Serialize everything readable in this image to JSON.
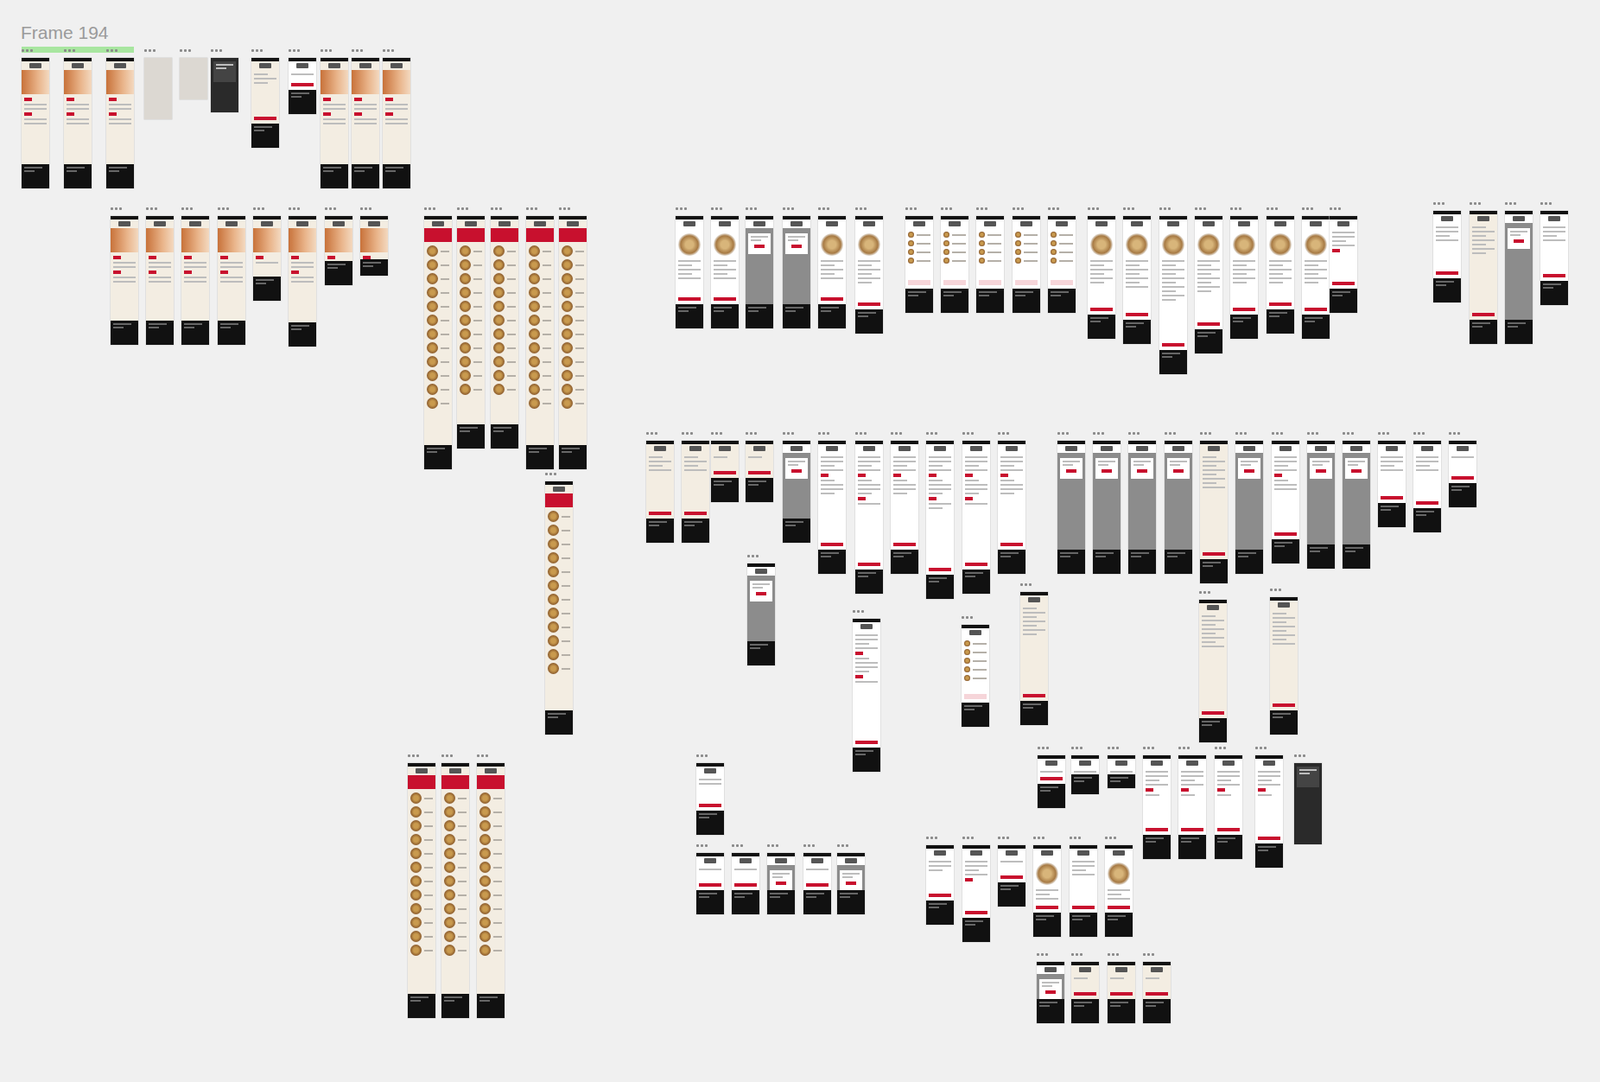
{
  "canvas": {
    "title": "Frame 194"
  },
  "frames": [
    {
      "kind": "hero"
    },
    {
      "kind": "hero"
    },
    {
      "kind": "hero"
    },
    {
      "kind": "blank"
    },
    {
      "kind": "blank"
    },
    {
      "kind": "dark"
    },
    {
      "kind": "beige"
    },
    {
      "kind": "form"
    },
    {
      "kind": "hero"
    },
    {
      "kind": "hero"
    },
    {
      "kind": "hero"
    },
    {
      "kind": "hero"
    },
    {
      "kind": "hero"
    },
    {
      "kind": "hero"
    },
    {
      "kind": "hero"
    },
    {
      "kind": "hero"
    },
    {
      "kind": "hero"
    },
    {
      "kind": "hero"
    },
    {
      "kind": "hero"
    },
    {
      "kind": "menu"
    },
    {
      "kind": "menu"
    },
    {
      "kind": "menu"
    },
    {
      "kind": "menu"
    },
    {
      "kind": "menu"
    },
    {
      "kind": "menu"
    },
    {
      "kind": "product"
    },
    {
      "kind": "product"
    },
    {
      "kind": "modal"
    },
    {
      "kind": "modal"
    },
    {
      "kind": "product"
    },
    {
      "kind": "product"
    },
    {
      "kind": "list"
    },
    {
      "kind": "list"
    },
    {
      "kind": "list"
    },
    {
      "kind": "list"
    },
    {
      "kind": "list"
    },
    {
      "kind": "product"
    },
    {
      "kind": "product"
    },
    {
      "kind": "product"
    },
    {
      "kind": "product"
    },
    {
      "kind": "product"
    },
    {
      "kind": "product"
    },
    {
      "kind": "product"
    },
    {
      "kind": "form"
    },
    {
      "kind": "form"
    },
    {
      "kind": "beige"
    },
    {
      "kind": "modal"
    },
    {
      "kind": "form"
    },
    {
      "kind": "beige"
    },
    {
      "kind": "beige"
    },
    {
      "kind": "beige"
    },
    {
      "kind": "beige"
    },
    {
      "kind": "modal"
    },
    {
      "kind": "form"
    },
    {
      "kind": "form"
    },
    {
      "kind": "form"
    },
    {
      "kind": "form"
    },
    {
      "kind": "form"
    },
    {
      "kind": "form"
    },
    {
      "kind": "modal"
    },
    {
      "kind": "modal"
    },
    {
      "kind": "modal"
    },
    {
      "kind": "modal"
    },
    {
      "kind": "beige"
    },
    {
      "kind": "modal"
    },
    {
      "kind": "form"
    },
    {
      "kind": "modal"
    },
    {
      "kind": "modal"
    },
    {
      "kind": "form"
    },
    {
      "kind": "form"
    },
    {
      "kind": "form"
    },
    {
      "kind": "modal"
    },
    {
      "kind": "form"
    },
    {
      "kind": "list"
    },
    {
      "kind": "beige"
    },
    {
      "kind": "beige"
    },
    {
      "kind": "beige"
    },
    {
      "kind": "menu"
    },
    {
      "kind": "menu"
    },
    {
      "kind": "menu"
    },
    {
      "kind": "form"
    },
    {
      "kind": "form"
    },
    {
      "kind": "form"
    },
    {
      "kind": "modal"
    },
    {
      "kind": "form"
    },
    {
      "kind": "modal"
    },
    {
      "kind": "form"
    },
    {
      "kind": "form"
    },
    {
      "kind": "form"
    },
    {
      "kind": "product"
    },
    {
      "kind": "form"
    },
    {
      "kind": "product"
    },
    {
      "kind": "form"
    },
    {
      "kind": "form"
    },
    {
      "kind": "form"
    },
    {
      "kind": "form"
    },
    {
      "kind": "form"
    },
    {
      "kind": "form"
    },
    {
      "kind": "form"
    },
    {
      "kind": "dark"
    },
    {
      "kind": "modal"
    },
    {
      "kind": "beige"
    },
    {
      "kind": "beige"
    },
    {
      "kind": "beige"
    }
  ]
}
